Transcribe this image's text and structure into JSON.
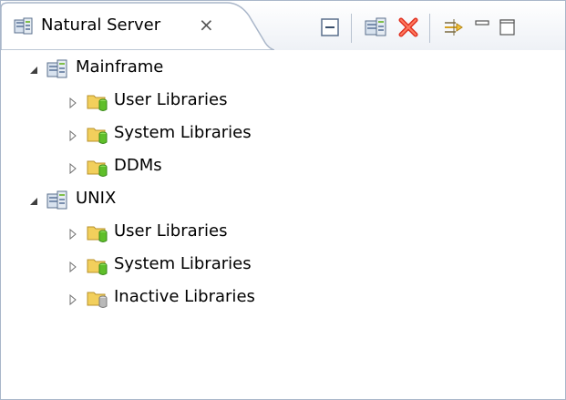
{
  "view": {
    "title": "Natural Server",
    "close_glyph": "⨯"
  },
  "toolbar": {
    "buttons": [
      "collapse-all-icon",
      "new-server-icon",
      "remove-icon",
      "link-with-editor-icon",
      "minimize-icon",
      "maximize-icon"
    ]
  },
  "tree": {
    "servers": [
      {
        "label": "Mainframe",
        "expanded": true,
        "children": [
          {
            "label": "User Libraries",
            "icon": "library-folder-icon"
          },
          {
            "label": "System Libraries",
            "icon": "library-folder-icon"
          },
          {
            "label": "DDMs",
            "icon": "library-folder-icon"
          }
        ]
      },
      {
        "label": "UNIX",
        "expanded": true,
        "children": [
          {
            "label": "User Libraries",
            "icon": "library-folder-icon"
          },
          {
            "label": "System Libraries",
            "icon": "library-folder-icon"
          },
          {
            "label": "Inactive Libraries",
            "icon": "inactive-library-folder-icon"
          }
        ]
      }
    ]
  },
  "colors": {
    "border": "#a9b6c9",
    "active_db": "#5fbf2a",
    "inactive_db": "#b9b9b9",
    "folder": "#f2cf5c",
    "remove": "#e03020"
  }
}
